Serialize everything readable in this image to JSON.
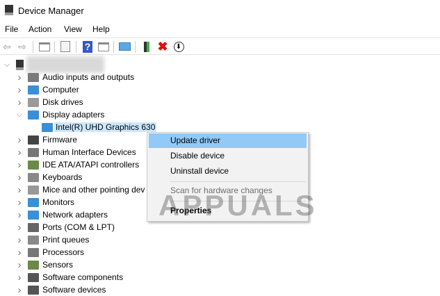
{
  "window": {
    "title": "Device Manager"
  },
  "menubar": [
    "File",
    "Action",
    "View",
    "Help"
  ],
  "toolbar": {
    "icons": [
      "back-icon",
      "forward-icon",
      "show-hide-console-tree-icon",
      "properties-icon",
      "help-icon",
      "action-pane-icon",
      "scan-hardware-icon",
      "update-driver-icon",
      "uninstall-icon",
      "disable-icon"
    ]
  },
  "tree": {
    "items": [
      {
        "label": "Audio inputs and outputs",
        "icon": "speaker-icon",
        "color": "#7a7a7a"
      },
      {
        "label": "Computer",
        "icon": "computer-icon",
        "color": "#3a8fd6"
      },
      {
        "label": "Disk drives",
        "icon": "disk-icon",
        "color": "#9a9a9a"
      },
      {
        "label": "Display adapters",
        "icon": "display-adapter-icon",
        "color": "#3a8fd6",
        "expanded": true
      },
      {
        "label": "Intel(R) UHD Graphics 630",
        "icon": "display-adapter-icon",
        "color": "#3a8fd6",
        "child": true,
        "selected": true
      },
      {
        "label": "Firmware",
        "icon": "chip-icon",
        "color": "#444"
      },
      {
        "label": "Human Interface Devices",
        "icon": "hid-icon",
        "color": "#777"
      },
      {
        "label": "IDE ATA/ATAPI controllers",
        "icon": "ide-icon",
        "color": "#6a8a4a"
      },
      {
        "label": "Keyboards",
        "icon": "keyboard-icon",
        "color": "#888"
      },
      {
        "label": "Mice and other pointing dev",
        "icon": "mouse-icon",
        "color": "#999"
      },
      {
        "label": "Monitors",
        "icon": "monitor-icon",
        "color": "#3a8fd6"
      },
      {
        "label": "Network adapters",
        "icon": "network-icon",
        "color": "#3a8fd6"
      },
      {
        "label": "Ports (COM & LPT)",
        "icon": "port-icon",
        "color": "#666"
      },
      {
        "label": "Print queues",
        "icon": "printer-icon",
        "color": "#888"
      },
      {
        "label": "Processors",
        "icon": "processor-icon",
        "color": "#777"
      },
      {
        "label": "Sensors",
        "icon": "sensor-icon",
        "color": "#6a8a4a"
      },
      {
        "label": "Software components",
        "icon": "software-component-icon",
        "color": "#555"
      },
      {
        "label": "Software devices",
        "icon": "software-device-icon",
        "color": "#555"
      }
    ]
  },
  "context_menu": {
    "items": [
      "Update driver",
      "Disable device",
      "Uninstall device",
      "Scan for hardware changes",
      "Properties"
    ]
  },
  "colors": {
    "menu_highlight": "#91c9f7",
    "selection": "#cce8ff"
  },
  "watermark": "APPUALS"
}
